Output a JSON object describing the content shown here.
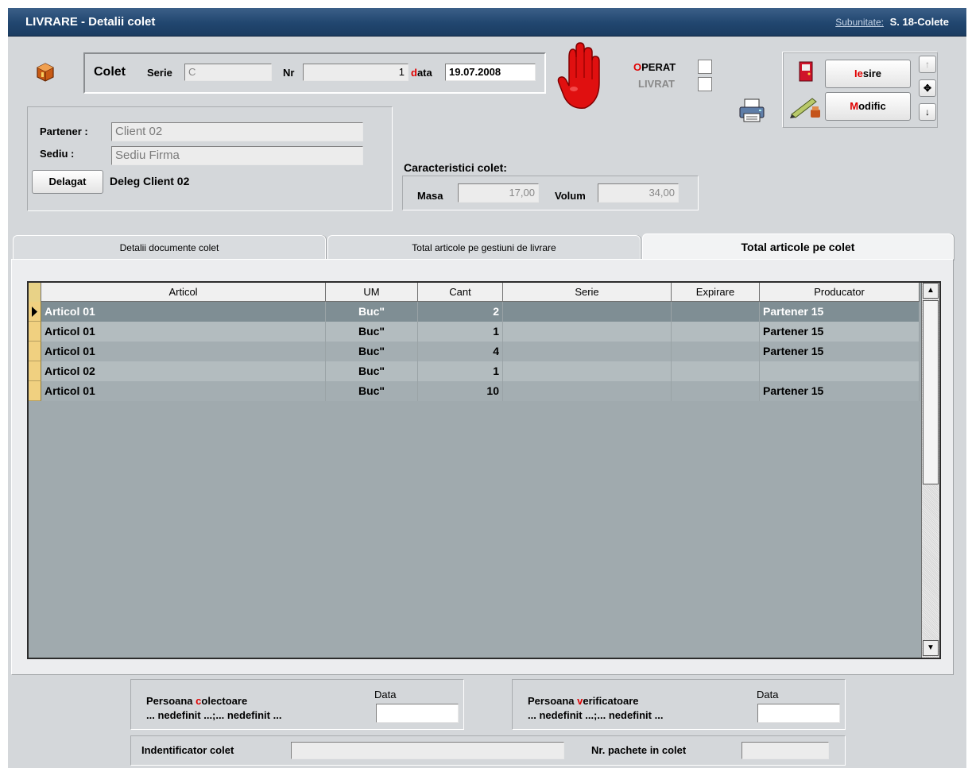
{
  "window": {
    "title": "LIVRARE - Detalii colet",
    "subunit_label": "Subunitate:",
    "subunit_value": "S. 18-Colete"
  },
  "colet": {
    "label": "Colet",
    "serie_label": "Serie",
    "serie_value": "C",
    "nr_label": "Nr",
    "nr_value": "1",
    "data_label_first": "d",
    "data_label_rest": "ata",
    "data_value": "19.07.2008"
  },
  "status": {
    "operat_first": "O",
    "operat_rest": "PERAT",
    "livrat": "LIVRAT"
  },
  "actions": {
    "iesire_first": "I",
    "iesire_mid": "e",
    "iesire_rest": "sire",
    "modific_first": "M",
    "modific_rest": "odific"
  },
  "partner": {
    "partener_label": "Partener :",
    "partener_value": "Client 02",
    "sediu_label": "Sediu :",
    "sediu_value": "Sediu Firma",
    "delegat_button": "Delagat",
    "delegat_value": "Deleg Client 02"
  },
  "caracteristici": {
    "title": "Caracteristici colet:",
    "masa_label": "Masa",
    "masa_value": "17,00",
    "volum_label": "Volum",
    "volum_value": "34,00"
  },
  "tabs": [
    {
      "label": "Detalii documente colet"
    },
    {
      "label": "Total articole pe gestiuni de livrare"
    },
    {
      "label": "Total articole pe colet"
    }
  ],
  "grid": {
    "columns": [
      "Articol",
      "UM",
      "Cant",
      "Serie",
      "Expirare",
      "Producator"
    ],
    "rows": [
      {
        "articol": "Articol 01",
        "um": "Buc\"",
        "cant": "2",
        "serie": "",
        "expirare": "",
        "producator": "Partener 15"
      },
      {
        "articol": "Articol 01",
        "um": "Buc\"",
        "cant": "1",
        "serie": "",
        "expirare": "",
        "producator": "Partener 15"
      },
      {
        "articol": "Articol 01",
        "um": "Buc\"",
        "cant": "4",
        "serie": "",
        "expirare": "",
        "producator": "Partener 15"
      },
      {
        "articol": "Articol 02",
        "um": "Buc\"",
        "cant": "1",
        "serie": "",
        "expirare": "",
        "producator": ""
      },
      {
        "articol": "Articol 01",
        "um": "Buc\"",
        "cant": "10",
        "serie": "",
        "expirare": "",
        "producator": "Partener 15"
      }
    ]
  },
  "footer": {
    "colectoare_pre": "Persoana ",
    "colectoare_key": "c",
    "colectoare_post": "olectoare",
    "colectoare_value": "... nedefinit ...;... nedefinit ...",
    "colectoare_data_label": "Data",
    "verificatoare_pre": "Persoana ",
    "verificatoare_key": "v",
    "verificatoare_post": "erificatoare",
    "verificatoare_value": "... nedefinit ...;... nedefinit ...",
    "verificatoare_data_label": "Data",
    "identificator_label": "Indentificator colet",
    "nr_pachete_label": "Nr. pachete in colet"
  },
  "colors": {
    "titlebar": "#21466f",
    "row_selected": "#7f8e94",
    "row_even": "#b3bcbf",
    "row_odd": "#a4aeb2",
    "accent_red": "#e00000"
  }
}
